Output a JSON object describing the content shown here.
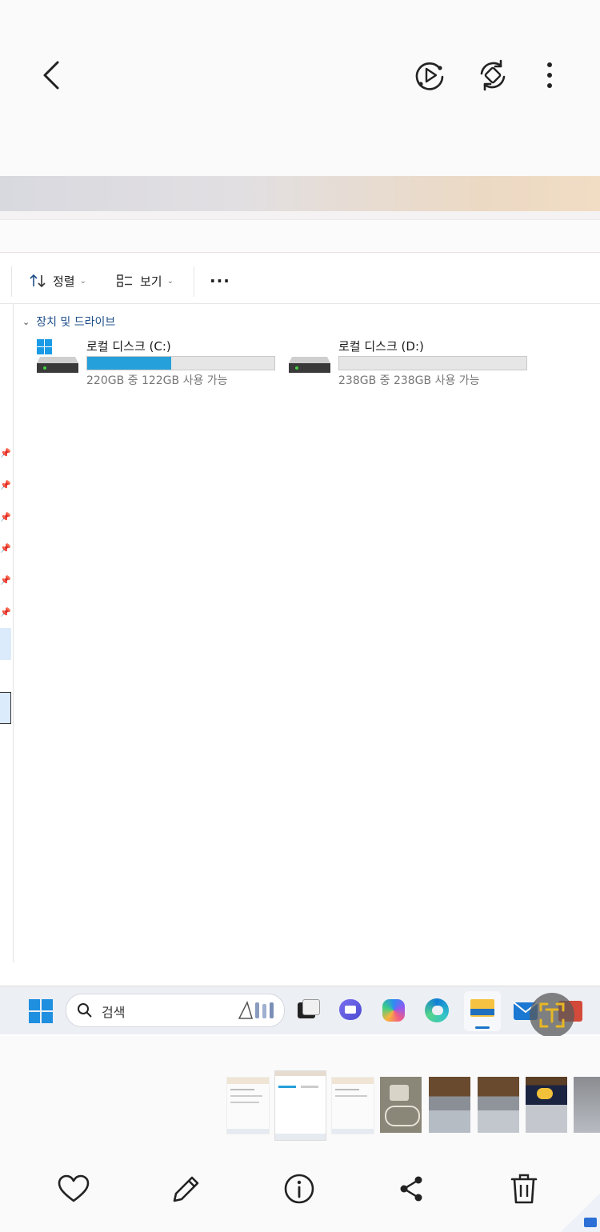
{
  "viewer": {
    "back_icon": "chevron-left-icon",
    "motion_icon": "motion-photo-play-icon",
    "rotate_icon": "rotate-icon",
    "more_icon": "more-vertical-icon"
  },
  "explorer": {
    "sort_label": "정렬",
    "view_label": "보기",
    "more_label": "···",
    "section_title": "장치 및 드라이브",
    "drives": [
      {
        "name": "로컬 디스크 (C:)",
        "free_text": "220GB 중 122GB 사용 가능",
        "used_fraction": 0.45,
        "os_drive": true
      },
      {
        "name": "로컬 디스크 (D:)",
        "free_text": "238GB 중 238GB 사용 가능",
        "used_fraction": 0.0,
        "os_drive": false
      }
    ]
  },
  "taskbar": {
    "search_placeholder": "검색",
    "apps": [
      "start-icon",
      "task-view-icon",
      "teams-icon",
      "copilot-icon",
      "edge-icon",
      "file-explorer-icon",
      "mail-icon",
      "office-icon"
    ]
  },
  "actions": {
    "favorite_icon": "heart-icon",
    "edit_icon": "pencil-icon",
    "info_icon": "info-icon",
    "share_icon": "share-icon",
    "delete_icon": "trash-icon"
  },
  "colors": {
    "accent": "#26a0da",
    "section": "#1e4f8a",
    "text_scan_ring": "#e7b724"
  }
}
